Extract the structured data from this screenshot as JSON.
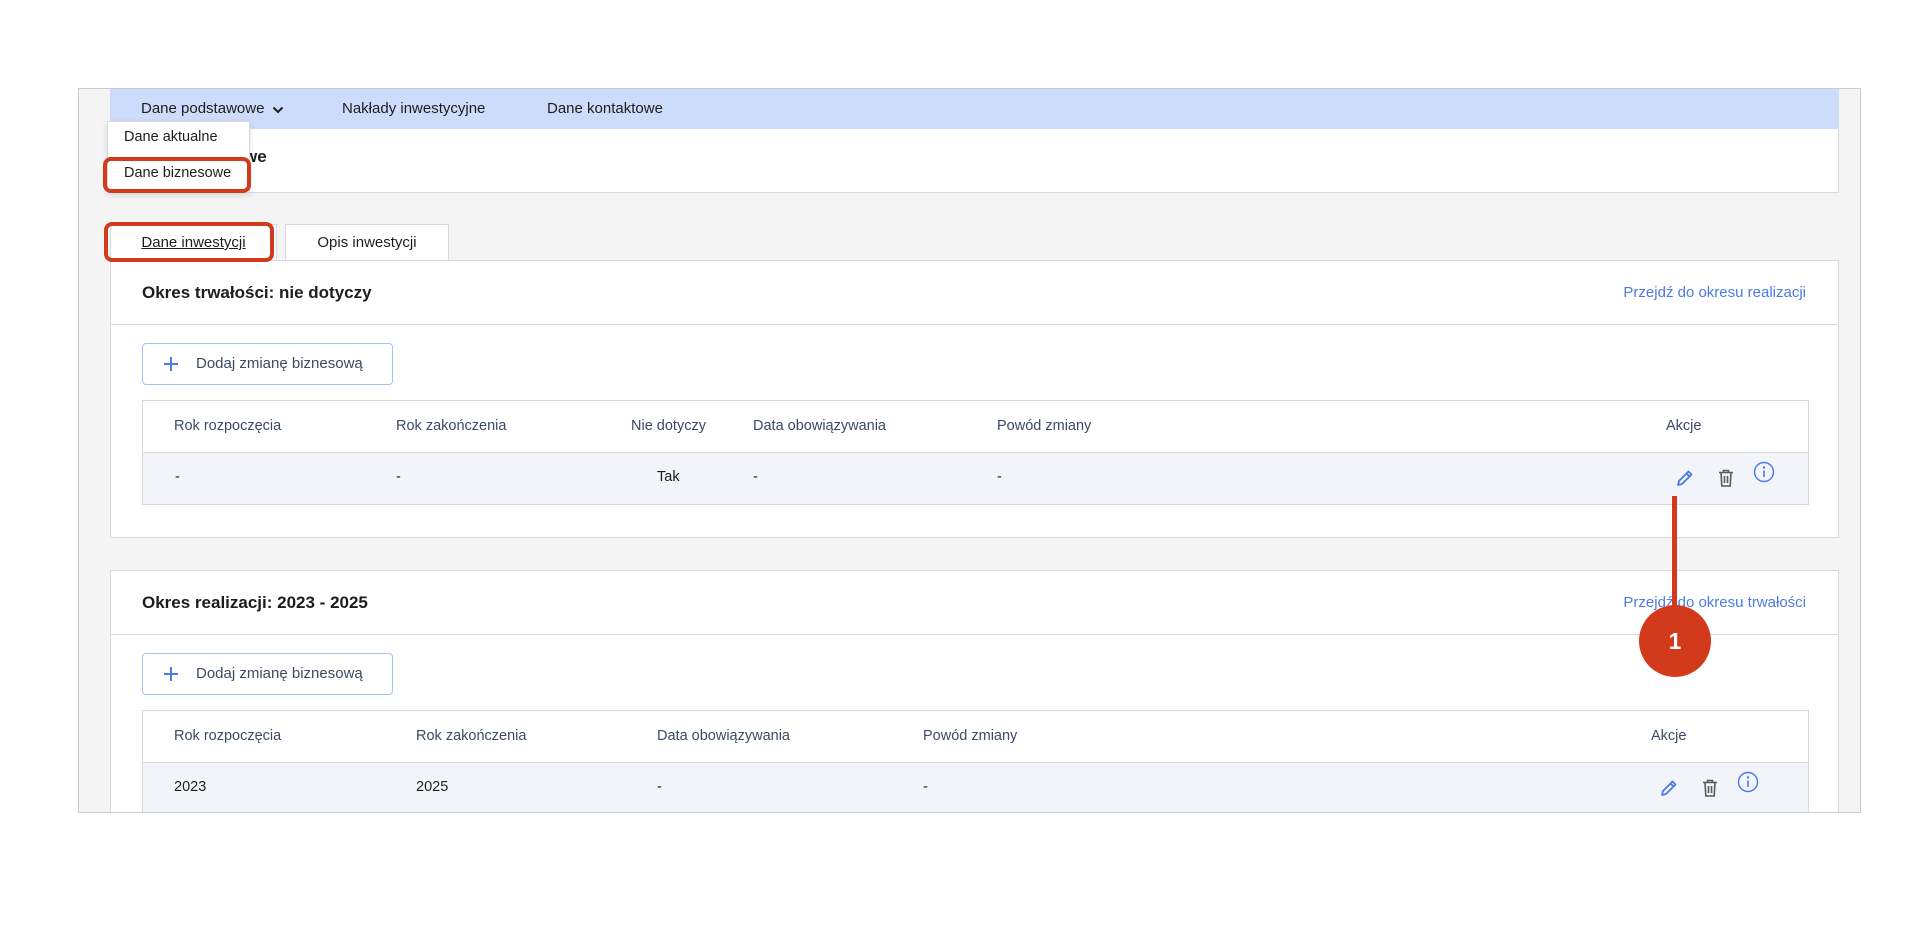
{
  "nav": {
    "items": [
      "Dane podstawowe",
      "Nakłady inwestycyjne",
      "Dane kontaktowe"
    ]
  },
  "header": {
    "title_visible_suffix": "we"
  },
  "dropdown": {
    "items": [
      "Dane aktualne",
      "Dane biznesowe"
    ]
  },
  "tabs": [
    {
      "label": "Dane inwestycji",
      "active": true
    },
    {
      "label": "Opis inwestycji",
      "active": false
    }
  ],
  "section1": {
    "title": "Okres trwałości: nie dotyczy",
    "link": "Przejdź do okresu realizacji",
    "add_button": "Dodaj zmianę biznesową",
    "columns": [
      "Rok rozpoczęcia",
      "Rok zakończenia",
      "Nie dotyczy",
      "Data obowiązywania",
      "Powód zmiany",
      "Akcje"
    ],
    "rows": [
      [
        "-",
        "-",
        "Tak",
        "-",
        "-"
      ]
    ]
  },
  "section2": {
    "title": "Okres realizacji: 2023 - 2025",
    "link": "Przejdź do okresu trwałości",
    "add_button": "Dodaj zmianę biznesową",
    "columns": [
      "Rok rozpoczęcia",
      "Rok zakończenia",
      "Data obowiązywania",
      "Powód zmiany",
      "Akcje"
    ],
    "rows": [
      [
        "2023",
        "2025",
        "-",
        "-"
      ]
    ]
  },
  "callout": {
    "number": "1"
  },
  "colors": {
    "nav_bg": "#cddcfb",
    "link": "#4b7be5",
    "accent_icon": "#4b7be5",
    "annotation": "#d23a1c"
  },
  "icons": [
    "chevron-down-icon",
    "plus-icon",
    "edit-pencil-icon",
    "trash-icon",
    "info-icon"
  ]
}
